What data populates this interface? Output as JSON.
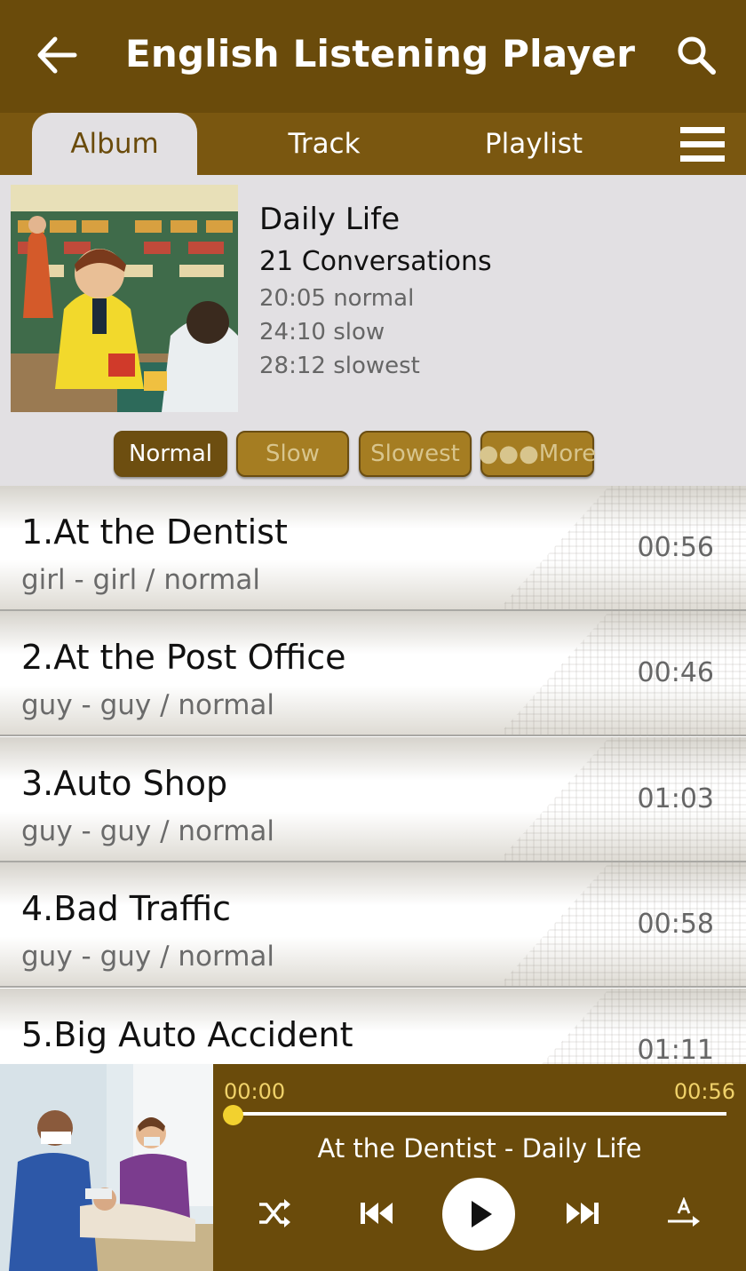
{
  "app_bar": {
    "title": "English Listening Player",
    "back_icon": "arrow-left-icon",
    "search_icon": "search-icon"
  },
  "tabs": [
    {
      "label": "Album",
      "active": true
    },
    {
      "label": "Track",
      "active": false
    },
    {
      "label": "Playlist",
      "active": false
    }
  ],
  "menu_icon": "hamburger-menu-icon",
  "album": {
    "name": "Daily Life",
    "count": "21 Conversations",
    "durations": [
      "20:05 normal",
      "24:10 slow",
      "28:12 slowest"
    ]
  },
  "speed_buttons": [
    {
      "label": "Normal",
      "selected": true
    },
    {
      "label": "Slow",
      "selected": false
    },
    {
      "label": "Slowest",
      "selected": false
    },
    {
      "label": "●●●More",
      "selected": false
    }
  ],
  "tracks": [
    {
      "title": "1.At the Dentist",
      "subtitle": "girl - girl / normal",
      "time": "00:56"
    },
    {
      "title": "2.At the Post Office",
      "subtitle": "guy - guy / normal",
      "time": "00:46"
    },
    {
      "title": "3.Auto Shop",
      "subtitle": "guy - guy / normal",
      "time": "01:03"
    },
    {
      "title": "4.Bad Traffic",
      "subtitle": "guy - guy / normal",
      "time": "00:58"
    },
    {
      "title": "5.Big Auto Accident",
      "subtitle": "",
      "time": "01:11"
    }
  ],
  "player": {
    "elapsed": "00:00",
    "total": "00:56",
    "progress": 0,
    "now_playing": "At the Dentist - Daily Life",
    "controls": [
      "shuffle-icon",
      "previous-icon",
      "play-icon",
      "next-icon",
      "text-display-icon"
    ]
  },
  "colors": {
    "brand_dark": "#6a4b0b",
    "tab_bar": "#7a5710",
    "panel_bg": "#e2e0e3",
    "accent_yellow": "#f2d12f",
    "time_text": "#f0d26a"
  }
}
